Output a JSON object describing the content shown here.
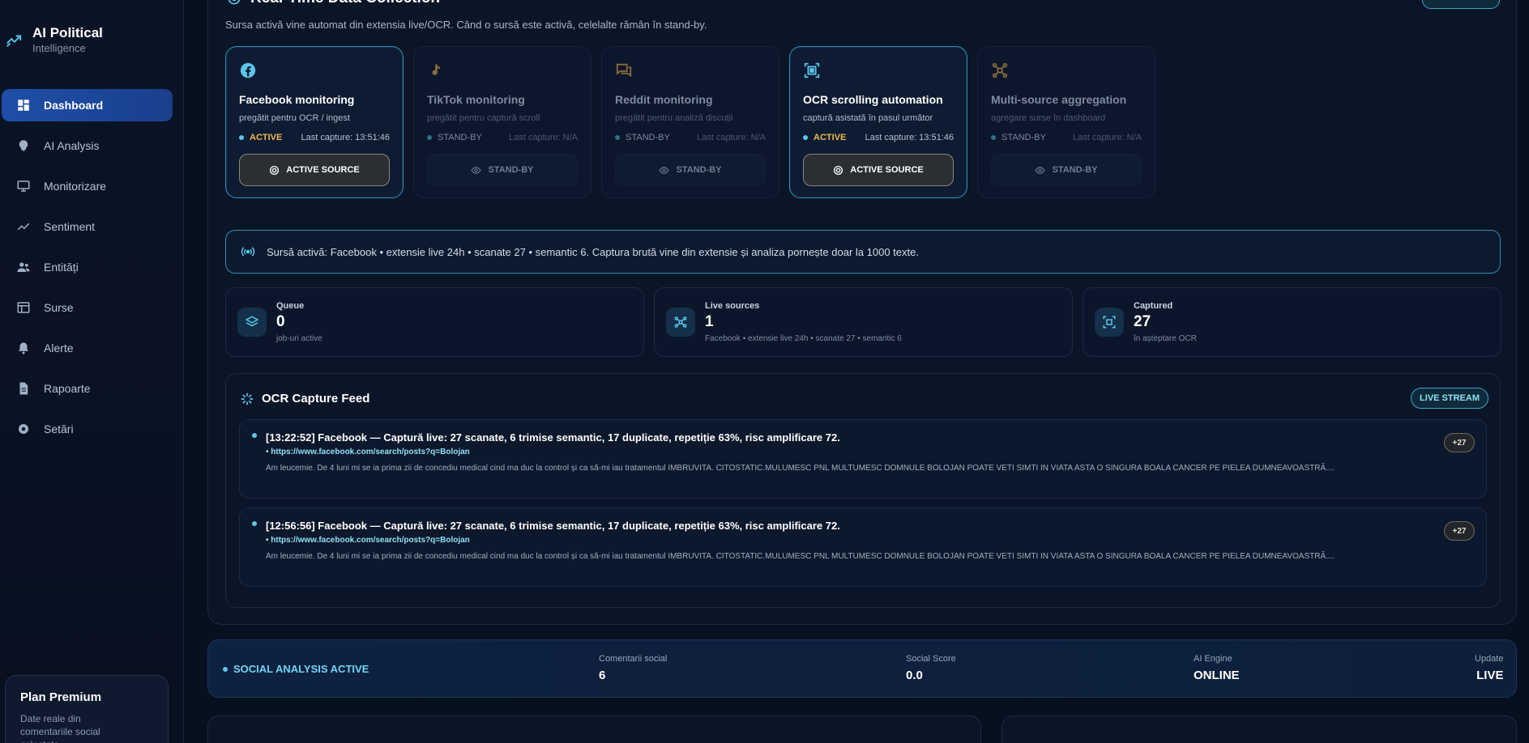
{
  "brand": {
    "title": "AI Political",
    "subtitle": "Intelligence"
  },
  "nav": [
    {
      "label": "Dashboard",
      "icon": "dashboard-icon",
      "active": true
    },
    {
      "label": "AI Analysis",
      "icon": "brain-icon"
    },
    {
      "label": "Monitorizare",
      "icon": "monitor-icon"
    },
    {
      "label": "Sentiment",
      "icon": "trend-icon"
    },
    {
      "label": "Entități",
      "icon": "people-icon"
    },
    {
      "label": "Surse",
      "icon": "sources-icon"
    },
    {
      "label": "Alerte",
      "icon": "bell-icon"
    },
    {
      "label": "Rapoarte",
      "icon": "document-icon"
    },
    {
      "label": "Setări",
      "icon": "gear-icon"
    }
  ],
  "plan": {
    "title": "Plan Premium",
    "text": "Date reale din comentariile social colectate."
  },
  "collection": {
    "title": "Real-Time Data Collection",
    "subtitle": "Sursa activă vine automat din extensia live/OCR. Când o sursă este activă, celelalte rămân în stand-by."
  },
  "sources": [
    {
      "title": "Facebook monitoring",
      "desc": "pregătit pentru OCR / ingest",
      "status": "ACTIVE",
      "last": "Last capture: 13:51:46",
      "button": "ACTIVE SOURCE",
      "active": true,
      "icon": "facebook-icon"
    },
    {
      "title": "TikTok monitoring",
      "desc": "pregătit pentru captură scroll",
      "status": "STAND-BY",
      "last": "Last capture: N/A",
      "button": "STAND-BY",
      "active": false,
      "icon": "tiktok-icon"
    },
    {
      "title": "Reddit monitoring",
      "desc": "pregătit pentru analiză discuții",
      "status": "STAND-BY",
      "last": "Last capture: N/A",
      "button": "STAND-BY",
      "active": false,
      "icon": "chat-icon"
    },
    {
      "title": "OCR scrolling automation",
      "desc": "captură asistată în pasul următor",
      "status": "ACTIVE",
      "last": "Last capture: 13:51:46",
      "button": "ACTIVE SOURCE",
      "active": true,
      "icon": "scan-icon"
    },
    {
      "title": "Multi-source aggregation",
      "desc": "agregare surse în dashboard",
      "status": "STAND-BY",
      "last": "Last capture: N/A",
      "button": "STAND-BY",
      "active": false,
      "icon": "hub-icon"
    }
  ],
  "banner": {
    "text": "Sursă activă: Facebook • extensie live 24h • scanate 27 • semantic 6. Captura brută vine din extensie și analiza pornește doar la 1000 texte."
  },
  "stats": [
    {
      "label": "Queue",
      "value": "0",
      "sub": "job-uri active",
      "icon": "layers-icon"
    },
    {
      "label": "Live sources",
      "value": "1",
      "sub": "Facebook • extensie live 24h • scanate 27 • semantic 6",
      "icon": "network-icon"
    },
    {
      "label": "Captured",
      "value": "27",
      "sub": "în așteptare OCR",
      "icon": "capture-icon"
    }
  ],
  "feed": {
    "title": "OCR Capture Feed",
    "pill": "LIVE STREAM",
    "items": [
      {
        "title": "[13:22:52] Facebook — Captură live: 27 scanate, 6 trimise semantic, 17 duplicate, repetiție 63%, risc amplificare 72.",
        "link": "• https://www.facebook.com/search/posts?q=Bolojan",
        "text": "Am leucemie. De 4 luni mi se ia prima zii de concediu medical cind ma duc la control și ca să-mi iau tratamentul IMBRUVITA. CITOSTATIC.MULUMESC PNL MULTUMESC DOMNULE BOLOJAN POATE VETI SIMTI IN VIATA ASTA O SINGURA BOALA CANCER PE PIELEA DUMNEAVOASTRĂ....",
        "badge": "+27"
      },
      {
        "title": "[12:56:56] Facebook — Captură live: 27 scanate, 6 trimise semantic, 17 duplicate, repetiție 63%, risc amplificare 72.",
        "link": "• https://www.facebook.com/search/posts?q=Bolojan",
        "text": "Am leucemie. De 4 luni mi se ia prima zii de concediu medical cind ma duc la control și ca să-mi iau tratamentul IMBRUVITA. CITOSTATIC.MULUMESC PNL MULTUMESC DOMNULE BOLOJAN POATE VETI SIMTI IN VIATA ASTA O SINGURA BOALA CANCER PE PIELEA DUMNEAVOASTRĂ....",
        "badge": "+27"
      }
    ]
  },
  "social": {
    "status": "SOCIAL ANALYSIS ACTIVE",
    "metrics": [
      {
        "label": "Comentarii social",
        "value": "6"
      },
      {
        "label": "Social Score",
        "value": "0.0"
      },
      {
        "label": "AI Engine",
        "value": "ONLINE"
      },
      {
        "label": "Update",
        "value": "LIVE"
      }
    ]
  },
  "colors": {
    "accent": "#2e8fb3",
    "active_status": "#f2b84a",
    "nav_active": "#1f4ea8",
    "live": "#5cc6ea"
  }
}
